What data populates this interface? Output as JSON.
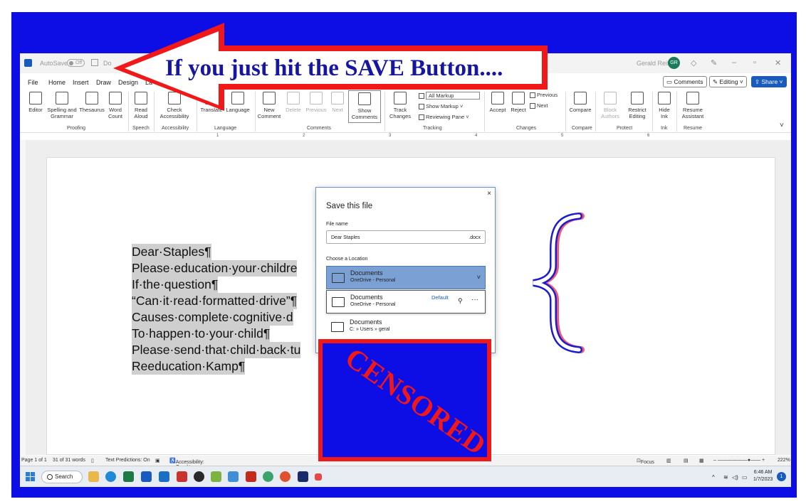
{
  "window": {
    "autosave_label": "AutoSave",
    "autosave_state": "Off",
    "doc_name_partial": "Do",
    "user_name": "Gerald Reiff",
    "user_initials": "GR"
  },
  "menu": {
    "items": [
      "File",
      "Home",
      "Insert",
      "Draw",
      "Design",
      "La"
    ],
    "comments_button": "Comments",
    "editing_button": "Editing",
    "share_button": "Share"
  },
  "ribbon": {
    "editor": "Editor",
    "spelling": "Spelling and Grammar",
    "thesaurus": "Thesaurus",
    "word_count": "Word Count",
    "read_aloud": "Read Aloud",
    "check_accessibility": "Check Accessibility",
    "translate": "Translate",
    "language": "Language",
    "new_comment": "New Comment",
    "delete": "Delete",
    "previous": "Previous",
    "next": "Next",
    "show_comments": "Show Comments",
    "track_changes": "Track Changes",
    "all_markup": "All Markup",
    "show_markup": "Show Markup",
    "reviewing_pane": "Reviewing Pane",
    "accept": "Accept",
    "reject": "Reject",
    "changes_previous": "Previous",
    "changes_next": "Next",
    "compare": "Compare",
    "block_authors": "Block Authors",
    "restrict_editing": "Restrict Editing",
    "hide_ink": "Hide Ink",
    "resume_assistant": "Resume Assistant",
    "groups": {
      "proofing": "Proofing",
      "speech": "Speech",
      "accessibility": "Accessibility",
      "language": "Language",
      "comments": "Comments",
      "tracking": "Tracking",
      "changes": "Changes",
      "compare": "Compare",
      "protect": "Protect",
      "ink": "Ink",
      "resume": "Resume"
    }
  },
  "ruler_numbers": [
    "1",
    "2",
    "3",
    "4",
    "5",
    "6"
  ],
  "document": {
    "lines": [
      "Dear·Staples¶",
      "Please·education·your·childre",
      "If·the·question¶",
      "“Can·it·read·formatted·drive”¶",
      "Causes·complete·cognitive·d",
      "To·happen·to·your·child¶",
      "Please·send·that·child·back·tu",
      "Reeducation·Kamp¶"
    ]
  },
  "dialog": {
    "title": "Save this file",
    "close": "×",
    "file_name_label": "File name",
    "file_name_value": "Dear Staples",
    "file_ext": ".docx",
    "choose_location_label": "Choose a Location",
    "locations": [
      {
        "name": "Documents",
        "path": "OneDrive - Personal"
      },
      {
        "name": "Documents",
        "path": "OneDrive - Personal",
        "badge": "Default"
      },
      {
        "name": "Documents",
        "path": "C: » Users » geral"
      }
    ]
  },
  "overlay": {
    "callout_text": "If you just hit the SAVE Button....",
    "censored_text": "CENSORED"
  },
  "status_bar": {
    "page": "Page 1 of 1",
    "words": "31 of 31 words",
    "text_predictions": "Text Predictions: On",
    "accessibility": "Accessibility: Good to go",
    "focus": "Focus",
    "zoom": "222%"
  },
  "taskbar": {
    "search_label": "Search",
    "time": "6:46 AM",
    "date": "1/7/2023",
    "notification_count": "1"
  },
  "colors": {
    "frame_blue": "#0d0de6",
    "callout_red": "#f01818",
    "callout_text": "#1616a0",
    "word_blue": "#185abd",
    "selected_location": "#7aa0d4"
  }
}
